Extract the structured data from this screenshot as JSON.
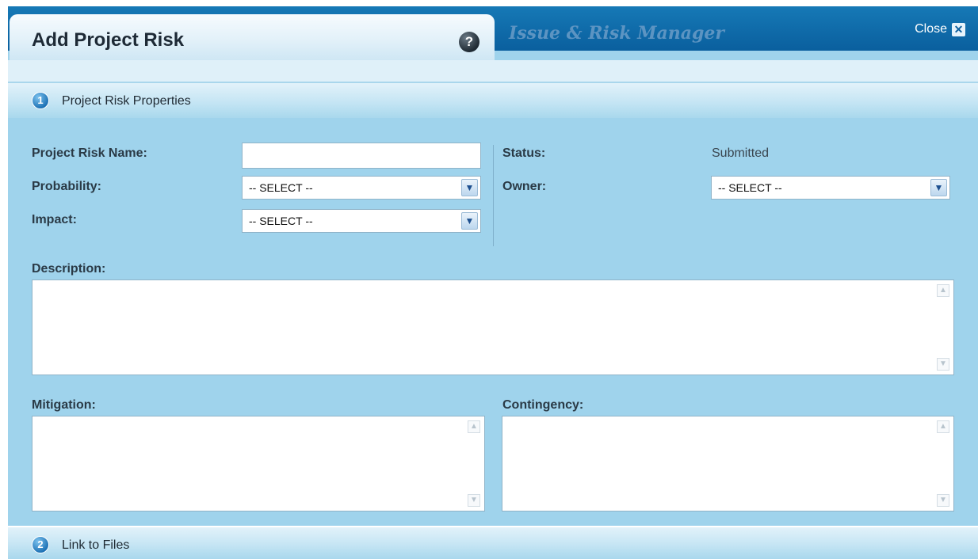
{
  "dialog": {
    "title": "Add Project Risk",
    "app_name": "Issue & Risk Manager",
    "close_label": "Close",
    "help_glyph": "?",
    "close_glyph": "✕"
  },
  "sections": [
    {
      "number": "1",
      "title": "Project Risk Properties"
    },
    {
      "number": "2",
      "title": "Link to Files"
    }
  ],
  "form": {
    "name_label": "Project Risk Name:",
    "name_value": "",
    "probability_label": "Probability:",
    "probability_value": "-- SELECT --",
    "impact_label": "Impact:",
    "impact_value": "-- SELECT --",
    "status_label": "Status:",
    "status_value": "Submitted",
    "owner_label": "Owner:",
    "owner_value": "-- SELECT --",
    "description_label": "Description:",
    "mitigation_label": "Mitigation:",
    "contingency_label": "Contingency:"
  },
  "glyphs": {
    "chevron_down": "▼",
    "scroll_up": "▲",
    "scroll_down": "▼"
  },
  "icons": [
    "help-icon",
    "close-icon",
    "section-number-icon",
    "chevron-down-icon"
  ],
  "colors": {
    "header_blue": "#0a5f9e",
    "panel_blue": "#9fd3ec",
    "title_text": "#1e2a36"
  }
}
